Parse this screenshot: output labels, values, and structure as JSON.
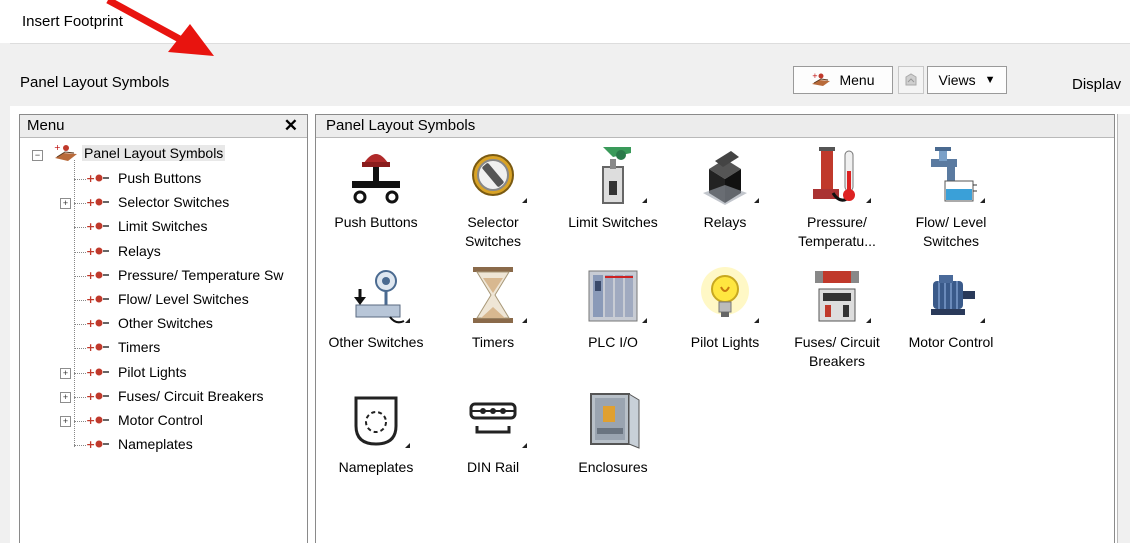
{
  "window": {
    "title": "Insert Footprint"
  },
  "toolbar": {
    "section_title": "Panel Layout Symbols",
    "menu_label": "Menu",
    "views_label": "Views",
    "display_label": "Displav"
  },
  "menu_panel": {
    "title": "Menu",
    "tree": {
      "root": "Panel Layout Symbols",
      "items": [
        {
          "label": "Push Buttons",
          "expandable": false
        },
        {
          "label": "Selector Switches",
          "expandable": true
        },
        {
          "label": "Limit Switches",
          "expandable": false
        },
        {
          "label": "Relays",
          "expandable": false
        },
        {
          "label": "Pressure/ Temperature Sw",
          "expandable": false
        },
        {
          "label": "Flow/ Level Switches",
          "expandable": false
        },
        {
          "label": "Other Switches",
          "expandable": false
        },
        {
          "label": "Timers",
          "expandable": false
        },
        {
          "label": "Pilot Lights",
          "expandable": true
        },
        {
          "label": "Fuses/ Circuit Breakers",
          "expandable": true
        },
        {
          "label": "Motor Control",
          "expandable": true
        },
        {
          "label": "Nameplates",
          "expandable": false
        }
      ]
    }
  },
  "content_panel": {
    "title": "Panel Layout Symbols",
    "tiles": [
      {
        "label": "Push Buttons",
        "icon": "push-button-icon"
      },
      {
        "label": "Selector\nSwitches",
        "icon": "selector-switch-icon"
      },
      {
        "label": "Limit Switches",
        "icon": "limit-switch-icon"
      },
      {
        "label": "Relays",
        "icon": "relay-icon"
      },
      {
        "label": "Pressure/\nTemperatu...",
        "icon": "pressure-temperature-icon"
      },
      {
        "label": "Flow/ Level\nSwitches",
        "icon": "flow-level-icon"
      },
      {
        "label": "Other Switches",
        "icon": "other-switches-icon"
      },
      {
        "label": "Timers",
        "icon": "hourglass-icon"
      },
      {
        "label": "PLC I/O",
        "icon": "plc-io-icon"
      },
      {
        "label": "Pilot Lights",
        "icon": "light-bulb-icon"
      },
      {
        "label": "Fuses/ Circuit\nBreakers",
        "icon": "fuse-breaker-icon"
      },
      {
        "label": "Motor Control",
        "icon": "motor-icon"
      },
      {
        "label": "Nameplates",
        "icon": "nameplate-icon"
      },
      {
        "label": "DIN Rail",
        "icon": "din-rail-icon"
      },
      {
        "label": "Enclosures",
        "icon": "enclosure-icon"
      }
    ]
  },
  "colors": {
    "annotation_arrow": "#e8140f",
    "chrome_background": "#f0f0f0"
  }
}
